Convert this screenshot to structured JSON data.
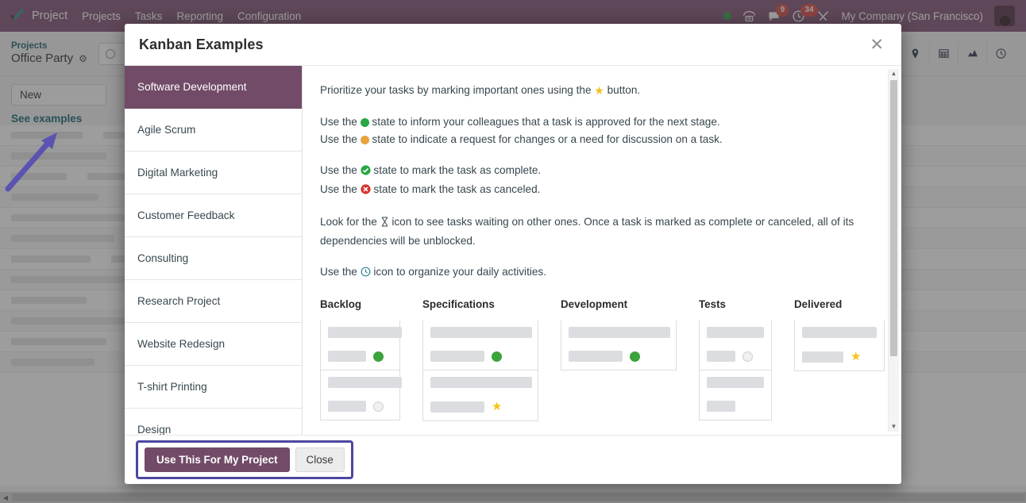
{
  "navbar": {
    "logo_icon": "checkmark-logo",
    "app_title": "Project",
    "menu": [
      {
        "label": "Projects"
      },
      {
        "label": "Tasks"
      },
      {
        "label": "Reporting"
      },
      {
        "label": "Configuration"
      }
    ],
    "status_dot_color": "#3fa34d",
    "icons": [
      {
        "name": "phone-icon",
        "badge": ""
      },
      {
        "name": "chat-icon",
        "badge": "9"
      },
      {
        "name": "clock-activity-icon",
        "badge": "34"
      },
      {
        "name": "tools-icon",
        "badge": ""
      }
    ],
    "company": "My Company (San Francisco)",
    "avatar_alt": "user-avatar"
  },
  "control_panel": {
    "breadcrumb_parent": "Projects",
    "breadcrumb_current": "Office Party",
    "gear_icon": "gear-icon",
    "search_placeholder": "",
    "search_value": "",
    "views": [
      {
        "name": "map-view-icon"
      },
      {
        "name": "list-view-icon"
      },
      {
        "name": "graph-view-icon"
      },
      {
        "name": "activity-view-icon"
      }
    ]
  },
  "subbar": {
    "new_button": "New",
    "see_examples_link": "See examples"
  },
  "modal": {
    "title": "Kanban Examples",
    "close_icon": "close-icon",
    "examples": [
      {
        "label": "Software Development",
        "active": true
      },
      {
        "label": "Agile Scrum",
        "active": false
      },
      {
        "label": "Digital Marketing",
        "active": false
      },
      {
        "label": "Customer Feedback",
        "active": false
      },
      {
        "label": "Consulting",
        "active": false
      },
      {
        "label": "Research Project",
        "active": false
      },
      {
        "label": "Website Redesign",
        "active": false
      },
      {
        "label": "T-shirt Printing",
        "active": false
      },
      {
        "label": "Design",
        "active": false
      }
    ],
    "content": {
      "p1_a": "Prioritize your tasks by marking important ones using the ",
      "p1_b": " button.",
      "p2_l1_a": "Use the ",
      "p2_l1_b": " state to inform your colleagues that a task is approved for the next stage.",
      "p2_l2_a": "Use the ",
      "p2_l2_b": " state to indicate a request for changes or a need for discussion on a task.",
      "p3_l1_a": "Use the ",
      "p3_l1_b": " state to mark the task as complete.",
      "p3_l2_a": "Use the ",
      "p3_l2_b": " state to mark the task as canceled.",
      "p4_a": "Look for the ",
      "p4_b": " icon to see tasks waiting on other ones. Once a task is marked as complete or canceled, all of its dependencies will be unblocked.",
      "p5_a": "Use the ",
      "p5_b": " icon to organize your daily activities."
    },
    "kanban_preview": {
      "columns": [
        {
          "title": "Backlog",
          "cards": [
            {
              "marker": "green-dot"
            },
            {
              "marker": "grey-dot"
            }
          ]
        },
        {
          "title": "Specifications",
          "cards": [
            {
              "marker": "green-dot"
            },
            {
              "marker": "star"
            }
          ]
        },
        {
          "title": "Development",
          "cards": [
            {
              "marker": "green-dot"
            }
          ]
        },
        {
          "title": "Tests",
          "cards": [
            {
              "marker": "grey-dot"
            },
            {
              "marker": "none"
            }
          ]
        },
        {
          "title": "Delivered",
          "cards": [
            {
              "marker": "star"
            }
          ]
        }
      ]
    },
    "footer": {
      "primary_button": "Use This For My Project",
      "secondary_button": "Close",
      "highlight_color": "#4a48a0"
    }
  },
  "colors": {
    "brand_purple": "#875a7b",
    "selected_item": "#714b67",
    "green_state": "#28a745",
    "orange_state": "#e8a33d",
    "star_yellow": "#f4c020",
    "cancel_red": "#d9342b",
    "annotation_purple": "#5a54b0"
  }
}
